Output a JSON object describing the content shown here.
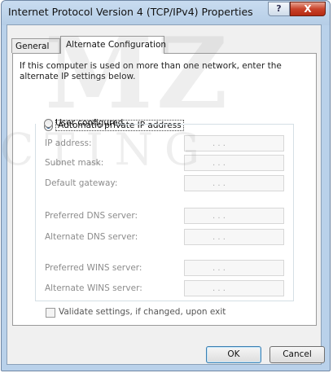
{
  "window": {
    "title": "Internet Protocol Version 4 (TCP/IPv4) Properties",
    "help_symbol": "?",
    "close_symbol": "X"
  },
  "tabs": [
    {
      "label": "General",
      "selected": false
    },
    {
      "label": "Alternate Configuration",
      "selected": true
    }
  ],
  "content": {
    "description": "If this computer is used on more than one network, enter the alternate IP settings below.",
    "option_auto": {
      "label": "Automatic private IP address",
      "selected": true
    },
    "option_user": {
      "label": "User configured",
      "selected": false
    }
  },
  "fields": [
    {
      "label": "IP address:",
      "value": ". . ."
    },
    {
      "label": "Subnet mask:",
      "value": ". . ."
    },
    {
      "label": "Default gateway:",
      "value": ". . ."
    },
    {
      "label": "Preferred DNS server:",
      "value": ". . ."
    },
    {
      "label": "Alternate DNS server:",
      "value": ". . ."
    },
    {
      "label": "Preferred WINS server:",
      "value": ". . ."
    },
    {
      "label": "Alternate WINS server:",
      "value": ". . ."
    }
  ],
  "validate": {
    "label": "Validate settings, if changed, upon exit",
    "checked": false
  },
  "buttons": {
    "ok": "OK",
    "cancel": "Cancel"
  },
  "watermark": {
    "line1": "MZ",
    "line2": "CTING"
  }
}
